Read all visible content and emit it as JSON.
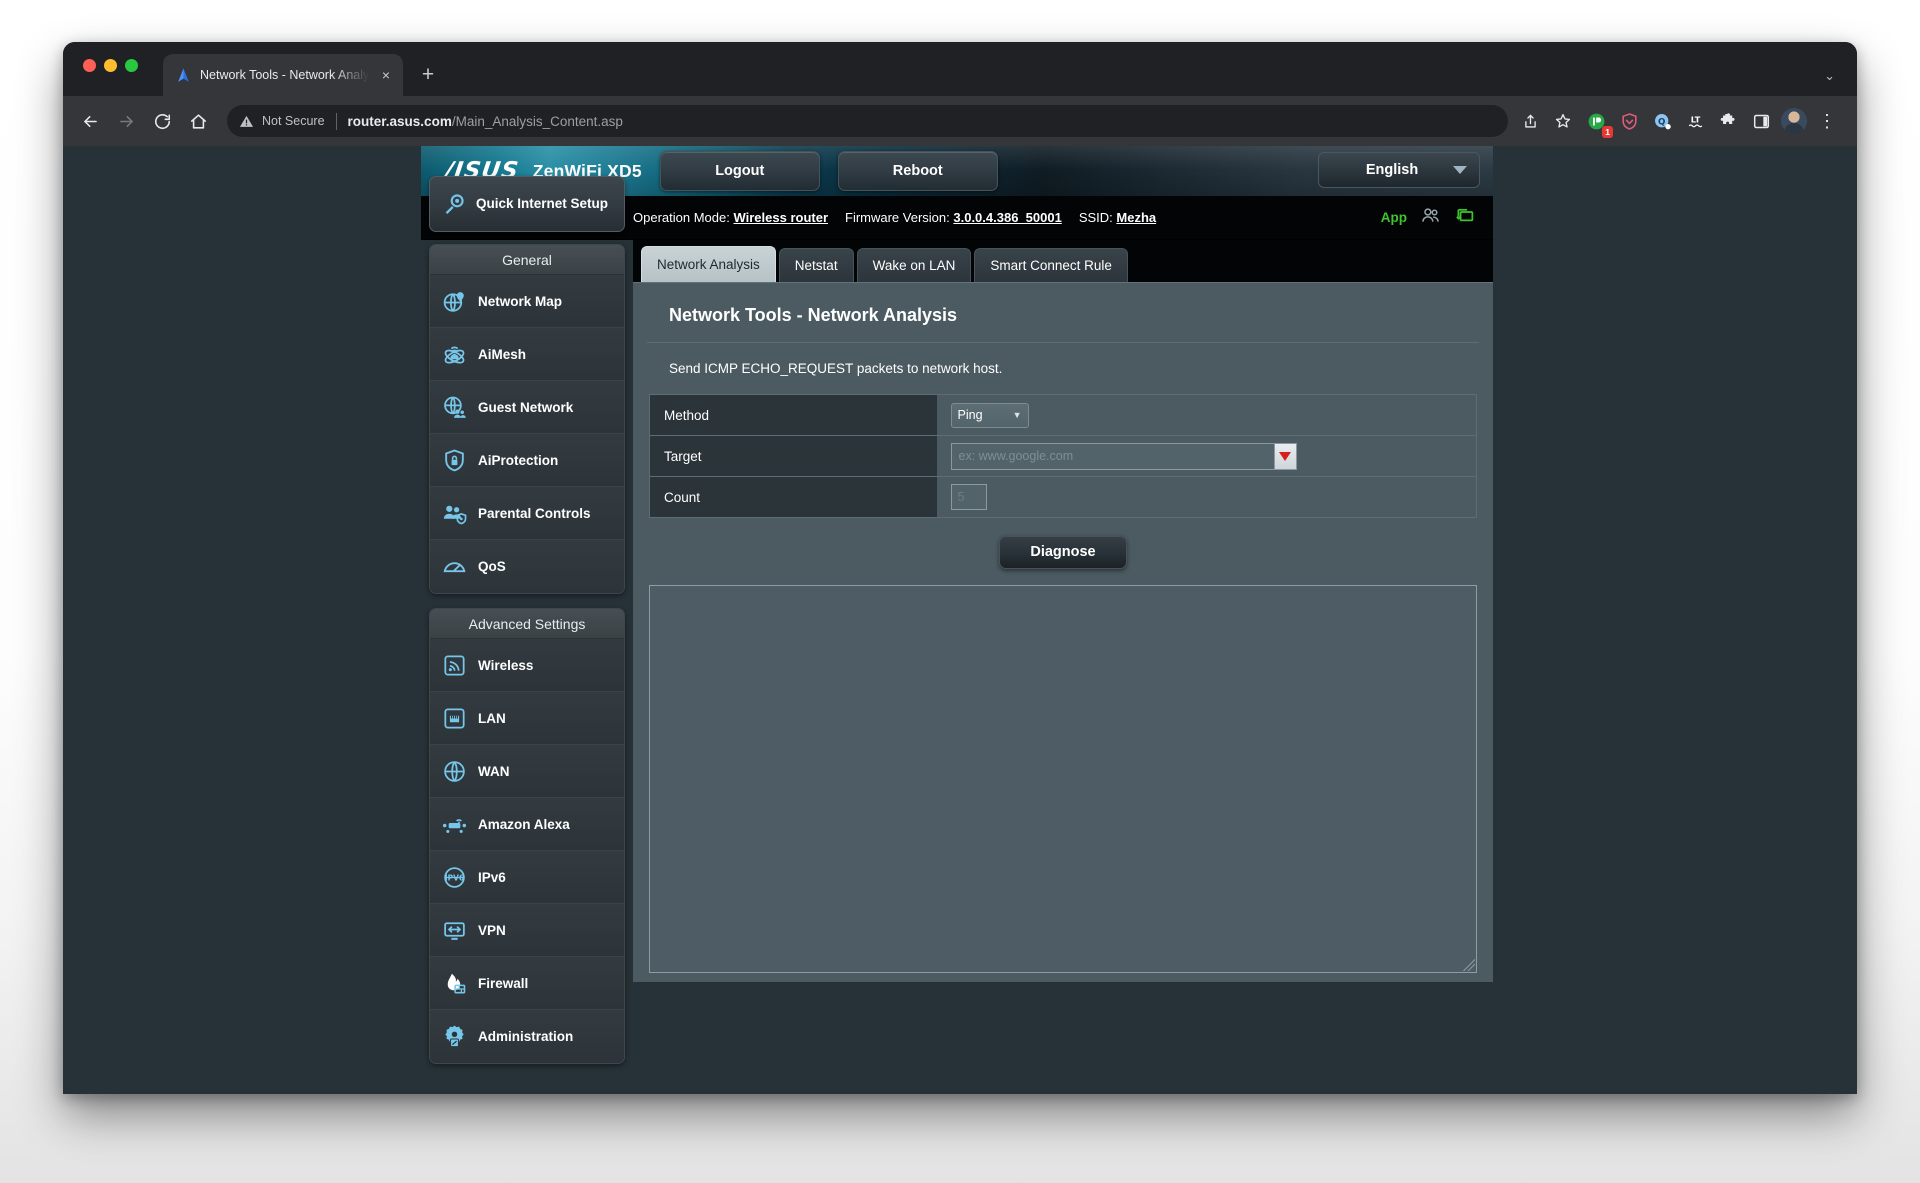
{
  "browser": {
    "tab": {
      "title": "Network Tools - Network Analy",
      "favicon": "asus-router-favicon",
      "close_label": "×"
    },
    "new_tab_label": "+",
    "tabstrip_chevron": "⌄",
    "nav": {
      "back": "←",
      "forward": "→",
      "reload": "↻",
      "home": "⌂"
    },
    "omnibox": {
      "security_label": "Not Secure",
      "host": "router.asus.com",
      "path": "/Main_Analysis_Content.asp"
    },
    "actions": {
      "share": "share-icon",
      "bookmark": "bookmark-star-icon",
      "ext_badge_count": "1",
      "menu": "⋮"
    }
  },
  "router": {
    "brand": "/ISUS",
    "model": "ZenWiFi XD5",
    "logout_label": "Logout",
    "reboot_label": "Reboot",
    "language": "English",
    "infobar": {
      "operation_mode_label": "Operation Mode:",
      "operation_mode_value": "Wireless router",
      "firmware_label": "Firmware Version:",
      "firmware_value": "3.0.0.4.386_50001",
      "ssid_label": "SSID:",
      "ssid_value": "Mezha",
      "app_label": "App"
    },
    "sidebar": {
      "quick_setup": "Quick Internet Setup",
      "groups": [
        {
          "title": "General",
          "items": [
            {
              "label": "Network Map",
              "icon": "network-map-icon"
            },
            {
              "label": "AiMesh",
              "icon": "aimesh-icon"
            },
            {
              "label": "Guest Network",
              "icon": "guest-network-icon"
            },
            {
              "label": "AiProtection",
              "icon": "shield-lock-icon"
            },
            {
              "label": "Parental Controls",
              "icon": "parental-controls-icon"
            },
            {
              "label": "QoS",
              "icon": "qos-gauge-icon"
            }
          ]
        },
        {
          "title": "Advanced Settings",
          "items": [
            {
              "label": "Wireless",
              "icon": "wireless-signal-icon"
            },
            {
              "label": "LAN",
              "icon": "lan-port-icon"
            },
            {
              "label": "WAN",
              "icon": "globe-icon"
            },
            {
              "label": "Amazon Alexa",
              "icon": "amazon-alexa-icon"
            },
            {
              "label": "IPv6",
              "icon": "ipv6-globe-icon"
            },
            {
              "label": "VPN",
              "icon": "vpn-monitor-icon"
            },
            {
              "label": "Firewall",
              "icon": "firewall-flame-icon"
            },
            {
              "label": "Administration",
              "icon": "administration-gear-icon"
            }
          ]
        }
      ]
    },
    "tabs": [
      {
        "label": "Network Analysis",
        "active": true
      },
      {
        "label": "Netstat",
        "active": false
      },
      {
        "label": "Wake on LAN",
        "active": false
      },
      {
        "label": "Smart Connect Rule",
        "active": false
      }
    ],
    "panel": {
      "title": "Network Tools - Network Analysis",
      "description": "Send ICMP ECHO_REQUEST packets to network host.",
      "fields": {
        "method_label": "Method",
        "method_value": "Ping",
        "target_label": "Target",
        "target_placeholder": "ex: www.google.com",
        "target_value": "",
        "count_label": "Count",
        "count_value": "5"
      },
      "diagnose_label": "Diagnose",
      "output_value": ""
    }
  },
  "colors": {
    "page_background": "#273238",
    "panel_background": "#4c5b62",
    "label_cell": "#2b3438",
    "accent_green": "#3fc42f",
    "dropdown_red": "#d81e1e",
    "icon_blue": "#76c6ea"
  }
}
